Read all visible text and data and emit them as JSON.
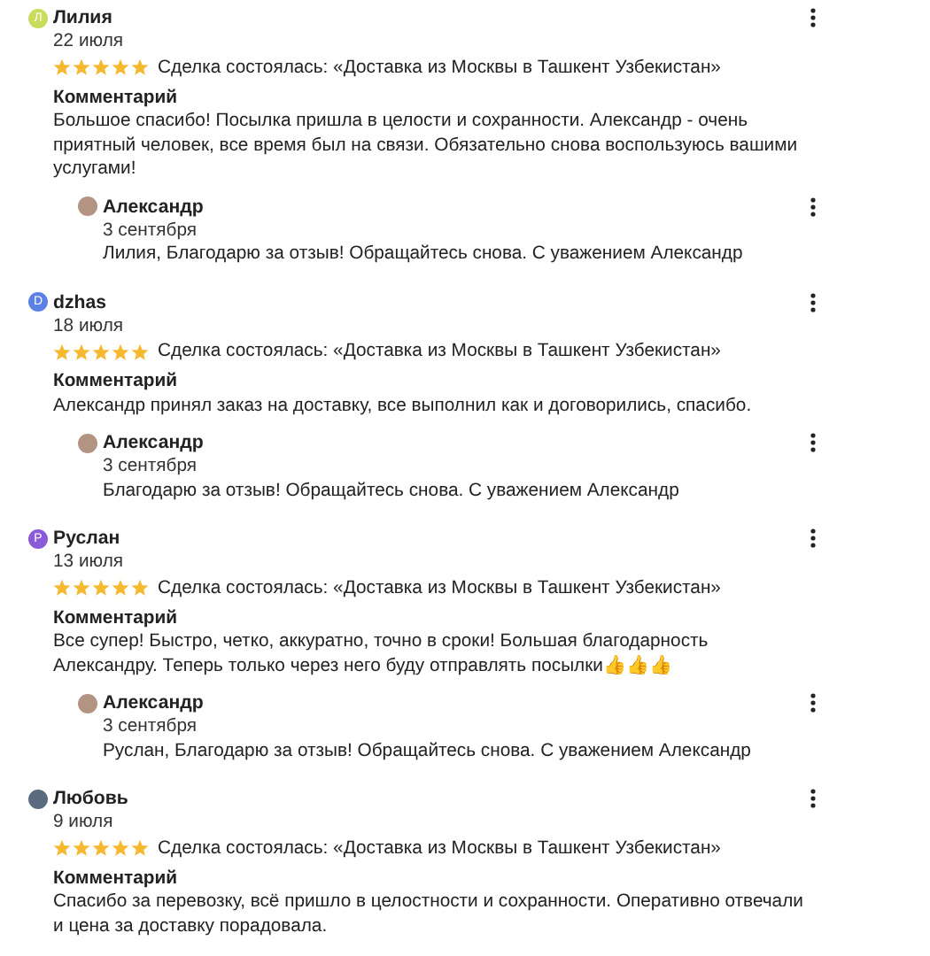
{
  "reviews": [
    {
      "avatar": {
        "kind": "letter",
        "letter": "Л",
        "color": "#c9dc5c"
      },
      "name": "Лилия",
      "date": "22 июля",
      "stars": 5,
      "deal": "Сделка состоялась: «Доставка из Москвы в Ташкент Узбекистан»",
      "comment_label": "Комментарий",
      "comment": "Большое спасибо! Посылка пришла в целости и сохранности. Александр - очень приятный человек, все время был на связи. Обязательно снова воспользуюсь вашими услугами!",
      "reply": {
        "name": "Александр",
        "date": "3 сентября",
        "text": "Лилия, Благодарю за отзыв! Обращайтесь снова. С уважением Александр"
      }
    },
    {
      "avatar": {
        "kind": "letter",
        "letter": "D",
        "color": "#5b80e6"
      },
      "name": "dzhas",
      "date": "18 июля",
      "stars": 5,
      "deal": "Сделка состоялась: «Доставка из Москвы в Ташкент Узбекистан»",
      "comment_label": "Комментарий",
      "comment": "Александр принял заказ на доставку, все выполнил как и договорились, спасибо.",
      "reply": {
        "name": "Александр",
        "date": "3 сентября",
        "text": "Благодарю за отзыв! Обращайтесь снова. С уважением Александр"
      }
    },
    {
      "avatar": {
        "kind": "letter",
        "letter": "P",
        "color": "#8a5ad8"
      },
      "name": "Руслан",
      "date": "13 июля",
      "stars": 5,
      "deal": "Сделка состоялась: «Доставка из Москвы в Ташкент Узбекистан»",
      "comment_label": "Комментарий",
      "comment": "Все супер! Быстро, четко, аккуратно, точно в сроки! Большая благодарность Александру. Теперь только через него буду отправлять посылки👍👍👍",
      "reply": {
        "name": "Александр",
        "date": "3 сентября",
        "text": "Руслан, Благодарю за отзыв! Обращайтесь снова. С уважением Александр"
      }
    },
    {
      "avatar": {
        "kind": "photo"
      },
      "name": "Любовь",
      "date": "9 июля",
      "stars": 5,
      "deal": "Сделка состоялась: «Доставка из Москвы в Ташкент Узбекистан»",
      "comment_label": "Комментарий",
      "comment": "Спасибо за перевозку, всё пришло в целостности и сохранности. Оперативно отвечали и цена за доставку порадовала."
    }
  ]
}
